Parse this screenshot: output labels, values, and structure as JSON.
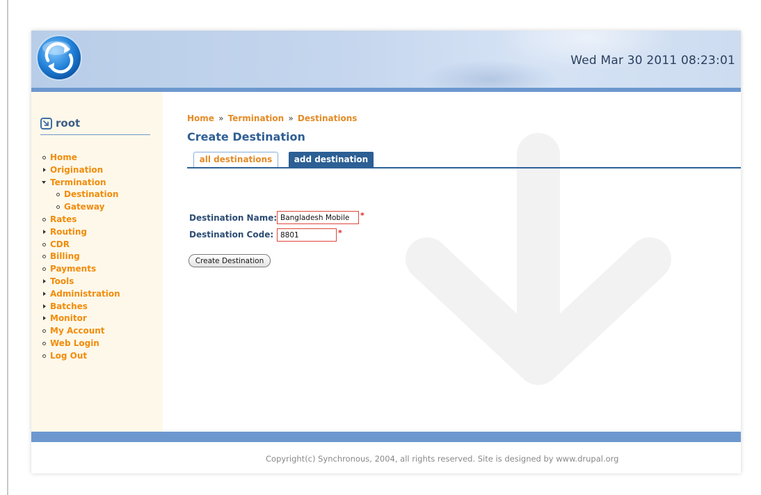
{
  "header": {
    "clock": "Wed Mar 30 2011 08:23:01",
    "logo_icon": "sync-logo-icon"
  },
  "sidebar": {
    "user": {
      "icon": "user-box-icon",
      "name": "root"
    },
    "menu": [
      {
        "label": "Home",
        "marker": "bullet",
        "level": 0
      },
      {
        "label": "Origination",
        "marker": "collapsed",
        "level": 0
      },
      {
        "label": "Termination",
        "marker": "expanded",
        "level": 0
      },
      {
        "label": "Destination",
        "marker": "bullet",
        "level": 1
      },
      {
        "label": "Gateway",
        "marker": "bullet",
        "level": 1
      },
      {
        "label": "Rates",
        "marker": "bullet",
        "level": 0
      },
      {
        "label": "Routing",
        "marker": "collapsed",
        "level": 0
      },
      {
        "label": "CDR",
        "marker": "bullet",
        "level": 0
      },
      {
        "label": "Billing",
        "marker": "bullet",
        "level": 0
      },
      {
        "label": "Payments",
        "marker": "bullet",
        "level": 0
      },
      {
        "label": "Tools",
        "marker": "collapsed",
        "level": 0
      },
      {
        "label": "Administration",
        "marker": "collapsed",
        "level": 0
      },
      {
        "label": "Batches",
        "marker": "collapsed",
        "level": 0
      },
      {
        "label": "Monitor",
        "marker": "collapsed",
        "level": 0
      },
      {
        "label": "My Account",
        "marker": "bullet",
        "level": 0
      },
      {
        "label": "Web Login",
        "marker": "bullet",
        "level": 0
      },
      {
        "label": "Log Out",
        "marker": "bullet",
        "level": 0
      }
    ]
  },
  "breadcrumb": {
    "items": [
      "Home",
      "Termination",
      "Destinations"
    ],
    "separator": "»"
  },
  "main": {
    "title": "Create Destination",
    "tabs": [
      {
        "label": "all destinations",
        "active": false
      },
      {
        "label": "add destination",
        "active": true
      }
    ],
    "form": {
      "name_label": "Destination Name:",
      "name_value": "Bangladesh Mobile",
      "code_label": "Destination Code:",
      "code_value": "8801",
      "required_marker": "*",
      "submit_label": "Create Destination"
    }
  },
  "footer": {
    "copyright": "Copyright(c) Synchronous, 2004, all rights reserved. Site is designed by www.drupal.org"
  },
  "colors": {
    "accent_blue": "#2c5f94",
    "link_orange": "#f28c0b",
    "sidebar_bg": "#fdf8ea",
    "bar_blue": "#6d98cf",
    "required_red": "#e02020"
  }
}
